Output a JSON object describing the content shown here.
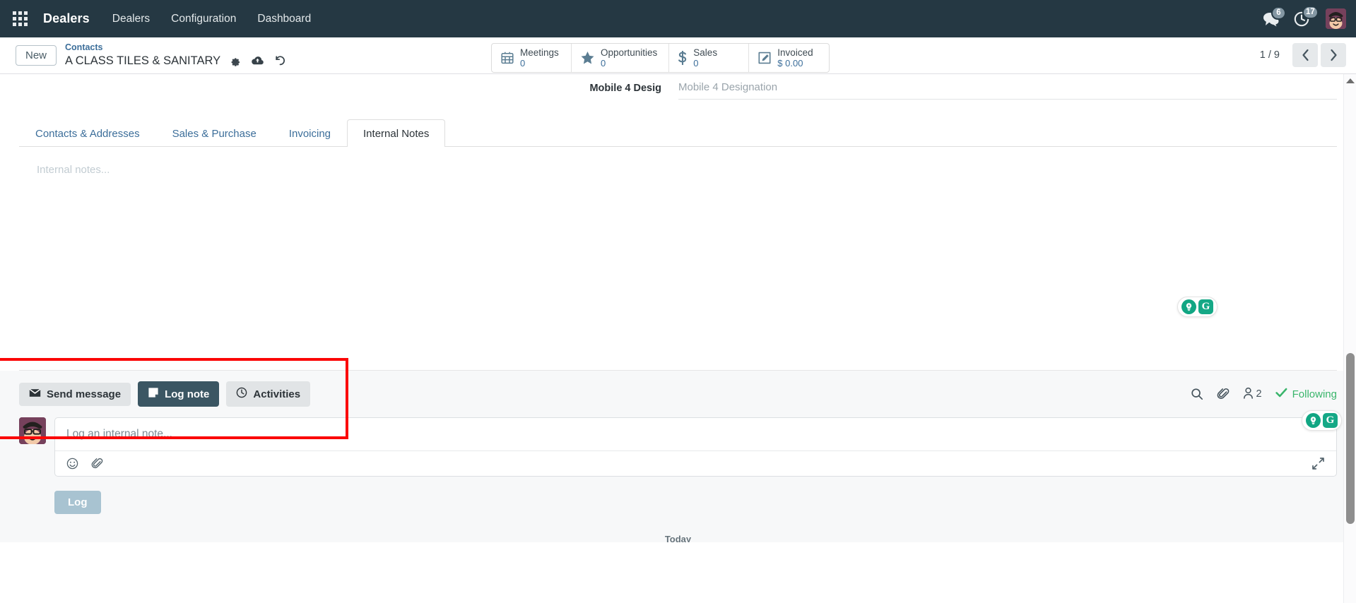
{
  "navbar": {
    "apps_icon": "apps-grid-icon",
    "brand": "Dealers",
    "menus": [
      {
        "label": "Dealers"
      },
      {
        "label": "Configuration"
      },
      {
        "label": "Dashboard"
      }
    ],
    "messages_icon": "messages-icon",
    "messages_count": "6",
    "activities_icon": "clock-activities-icon",
    "activities_count": "17",
    "avatar": "user-avatar"
  },
  "control_panel": {
    "new_label": "New",
    "breadcrumb_parent": "Contacts",
    "record_title": "A CLASS TILES & SANITARY",
    "gear_icon": "gear-icon",
    "cloud_icon": "cloud-upload-icon",
    "discard_icon": "undo-discard-icon",
    "stat_buttons": [
      {
        "icon": "calendar-icon",
        "label": "Meetings",
        "value": "0"
      },
      {
        "icon": "star-icon",
        "label": "Opportunities",
        "value": "0"
      },
      {
        "icon": "dollar-icon",
        "label": "Sales",
        "value": "0"
      },
      {
        "icon": "pencil-square-icon",
        "label": "Invoiced",
        "value": "$ 0.00"
      }
    ],
    "pager_text": "1 / 9",
    "prev_icon": "chevron-left-icon",
    "next_icon": "chevron-right-icon"
  },
  "form": {
    "field_row": {
      "label": "Mobile 4 Desig",
      "placeholder": "Mobile 4 Designation",
      "value": ""
    },
    "tabs": [
      {
        "label": "Contacts & Addresses",
        "active": false
      },
      {
        "label": "Sales & Purchase",
        "active": false
      },
      {
        "label": "Invoicing",
        "active": false
      },
      {
        "label": "Internal Notes",
        "active": true
      }
    ],
    "notes_placeholder": "Internal notes...",
    "notes_value": "",
    "grammarly": {
      "bulb_icon": "grammarly-suggestion-bulb-icon",
      "logo": "G"
    }
  },
  "chatter": {
    "buttons": [
      {
        "label": "Send message",
        "icon": "envelope-icon",
        "active": false
      },
      {
        "label": "Log note",
        "icon": "note-icon",
        "active": true
      },
      {
        "label": "Activities",
        "icon": "clock-icon",
        "active": false
      }
    ],
    "search_icon": "search-icon",
    "attachment_icon": "paperclip-icon",
    "follower_icon": "user-followers-icon",
    "follower_count": "2",
    "following_icon": "check-icon",
    "following_label": "Following",
    "composer": {
      "avatar": "user-avatar",
      "placeholder": "Log an internal note...",
      "value": "",
      "emoji_icon": "emoji-smiley-icon",
      "attach_icon": "paperclip-icon",
      "expand_icon": "expand-arrows-icon",
      "grammarly": {
        "bulb_icon": "grammarly-suggestion-bulb-icon",
        "logo": "G"
      }
    },
    "log_button_label": "Log",
    "day_separator": "Today"
  },
  "annotation": {
    "color": "#fb0707"
  },
  "scrollbar": {
    "up_arrow_icon": "scroll-up-arrow-icon",
    "thumb": "scroll-thumb"
  }
}
